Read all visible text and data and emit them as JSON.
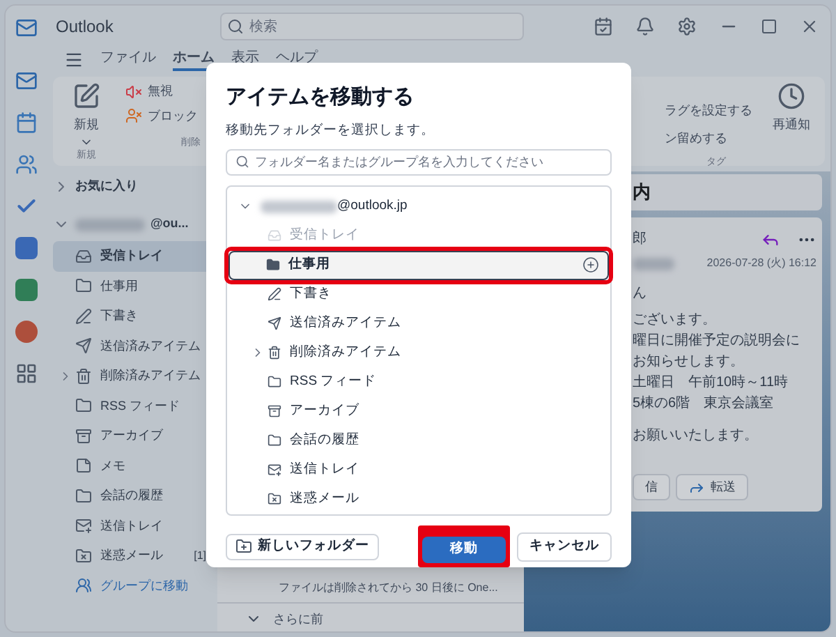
{
  "app": {
    "title": "Outlook",
    "search_placeholder": "検索"
  },
  "ribbon_tabs": [
    {
      "label": "ファイル",
      "selected": false
    },
    {
      "label": "ホーム",
      "selected": true
    },
    {
      "label": "表示",
      "selected": false
    },
    {
      "label": "ヘルプ",
      "selected": false
    }
  ],
  "ribbon": {
    "new_label": "新規",
    "group_new": "新規",
    "ignore": "無視",
    "block": "ブロック",
    "group_delete": "削除",
    "flag": "ラグを設定する",
    "pin": "ン留めする",
    "group_tag": "タグ",
    "snooze": "再通知"
  },
  "folder_pane": {
    "favorites": "お気に入り",
    "account": "@ou...",
    "folders": [
      {
        "kind": "inbox",
        "label": "受信トレイ",
        "selected": true,
        "collapsible": false
      },
      {
        "kind": "folder",
        "label": "仕事用",
        "selected": false,
        "collapsible": false
      },
      {
        "kind": "drafts",
        "label": "下書き",
        "selected": false,
        "collapsible": false
      },
      {
        "kind": "sent",
        "label": "送信済みアイテム",
        "selected": false,
        "collapsible": false
      },
      {
        "kind": "trash",
        "label": "削除済みアイテム",
        "selected": false,
        "collapsible": true
      },
      {
        "kind": "folder",
        "label": "RSS フィード",
        "selected": false,
        "collapsible": false
      },
      {
        "kind": "archive",
        "label": "アーカイブ",
        "selected": false,
        "collapsible": false
      },
      {
        "kind": "note",
        "label": "メモ",
        "selected": false,
        "collapsible": false
      },
      {
        "kind": "folder",
        "label": "会話の履歴",
        "selected": false,
        "collapsible": false
      },
      {
        "kind": "outbox",
        "label": "送信トレイ",
        "selected": false,
        "collapsible": false
      },
      {
        "kind": "junk",
        "label": "迷惑メール",
        "selected": false,
        "collapsible": false,
        "count": "[1]"
      },
      {
        "kind": "group",
        "label": "グループに移動",
        "selected": false,
        "collapsible": false,
        "link": true
      }
    ]
  },
  "message_list": {
    "notice": "ファイルは削除されてから 30 日後に One...",
    "section": "さらに前"
  },
  "reading_pane": {
    "subject": "内",
    "sender": "郎",
    "date": "2026-07-28 (火) 16:12",
    "greeting": "ん",
    "paragraphs": [
      [
        "ございます。",
        "曜日に開催予定の説明会に",
        "お知らせします。",
        "土曜日　午前10時～11時",
        "5棟の6階　東京会議室"
      ],
      [
        "お願いいたします。"
      ]
    ],
    "buttons": [
      {
        "label": "信"
      },
      {
        "kind": "forward",
        "label": "転送"
      }
    ]
  },
  "dialog": {
    "title": "アイテムを移動する",
    "subtitle": "移動先フォルダーを選択します。",
    "search_placeholder": "フォルダー名またはグループ名を入力してください",
    "account": "@outlook.jp",
    "expanded": true,
    "folders": [
      {
        "kind": "inbox",
        "label": "受信トレイ",
        "selected": false,
        "disabled": true,
        "collapsible": false,
        "highlighted": false
      },
      {
        "kind": "folder-filled",
        "label": "仕事用",
        "selected": true,
        "disabled": false,
        "collapsible": false,
        "highlighted": true
      },
      {
        "kind": "drafts",
        "label": "下書き",
        "selected": false,
        "disabled": false,
        "collapsible": false,
        "highlighted": false
      },
      {
        "kind": "sent",
        "label": "送信済みアイテム",
        "selected": false,
        "disabled": false,
        "collapsible": false,
        "highlighted": false
      },
      {
        "kind": "trash",
        "label": "削除済みアイテム",
        "selected": false,
        "disabled": false,
        "collapsible": true,
        "highlighted": false
      },
      {
        "kind": "folder",
        "label": "RSS フィード",
        "selected": false,
        "disabled": false,
        "collapsible": false,
        "highlighted": false
      },
      {
        "kind": "archive",
        "label": "アーカイブ",
        "selected": false,
        "disabled": false,
        "collapsible": false,
        "highlighted": false
      },
      {
        "kind": "folder",
        "label": "会話の履歴",
        "selected": false,
        "disabled": false,
        "collapsible": false,
        "highlighted": false
      },
      {
        "kind": "outbox",
        "label": "送信トレイ",
        "selected": false,
        "disabled": false,
        "collapsible": false,
        "highlighted": false
      },
      {
        "kind": "junk",
        "label": "迷惑メール",
        "selected": false,
        "disabled": false,
        "collapsible": false,
        "highlighted": false
      }
    ],
    "new_folder": "新しいフォルダー",
    "move": {
      "label": "移動",
      "highlighted": true
    },
    "cancel": "キャンセル"
  }
}
